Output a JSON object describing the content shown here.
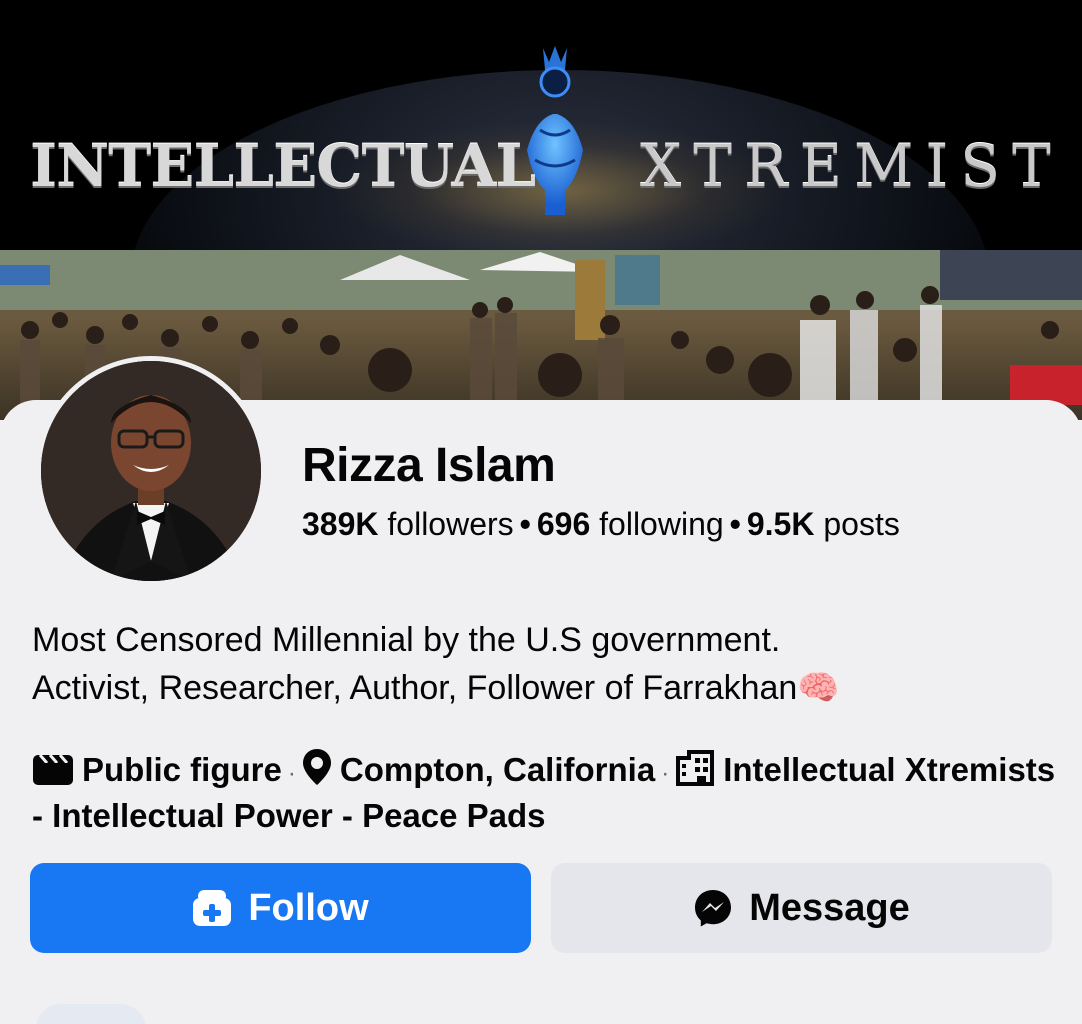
{
  "cover": {
    "left_text": "INTELLECTUAL",
    "right_text": "XTREMIST"
  },
  "profile": {
    "name": "Rizza Islam",
    "followers_count": "389K",
    "followers_label": "followers",
    "following_count": "696",
    "following_label": "following",
    "posts_count": "9.5K",
    "posts_label": "posts",
    "stat_separator": "•"
  },
  "bio": {
    "line1": "Most Censored Millennial by the U.S government.",
    "line2": "Activist, Researcher, Author, Follower of Farrakhan",
    "emoji": "🧠"
  },
  "details": {
    "category": "Public figure",
    "category_icon": "clapperboard-icon",
    "location": "Compton, California",
    "location_icon": "location-pin-icon",
    "workplace": "Intellectual Xtremists - Intellectual Power - Peace Pads",
    "workplace_icon": "building-icon",
    "separator": "·"
  },
  "actions": {
    "follow_label": "Follow",
    "follow_icon": "follow-badge-icon",
    "message_label": "Message",
    "message_icon": "messenger-icon"
  },
  "colors": {
    "follow_button": "#1877f2",
    "message_button": "#e4e6eb",
    "background": "#f0f0f2"
  }
}
